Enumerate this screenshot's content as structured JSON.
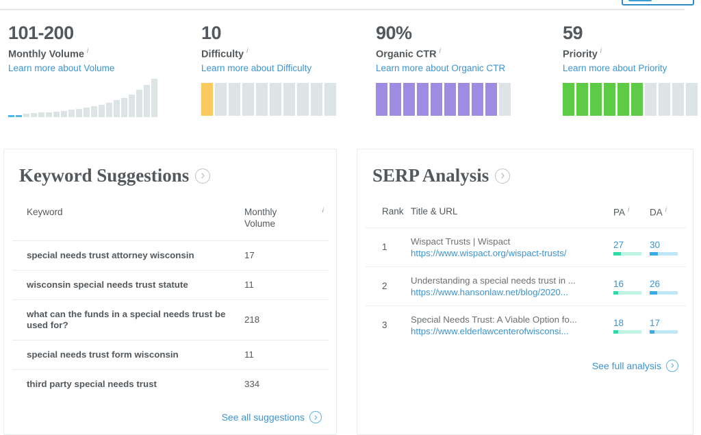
{
  "top_bar": {
    "button_name": "toolbar-button"
  },
  "metrics": [
    {
      "id": "monthly-volume",
      "value": "101-200",
      "label": "Monthly Volume",
      "info_icon": "info-icon",
      "link": "Learn more about Volume",
      "meter_type": "sparkline",
      "sparkline": {
        "bars": [
          3,
          3,
          5,
          6,
          7,
          7,
          8,
          9,
          11,
          12,
          14,
          16,
          18,
          21,
          25,
          29,
          34,
          41,
          48,
          57
        ],
        "highlight_count": 2,
        "highlight_color": "#4db8ec",
        "track_color": "#dde4e5"
      }
    },
    {
      "id": "difficulty",
      "value": "10",
      "label": "Difficulty",
      "info_icon": "info-icon",
      "link": "Learn more about Difficulty",
      "meter_type": "segments",
      "segments_total": 10,
      "segments_filled": 1,
      "fill_color": "#fbca5f",
      "track_color": "#dde4e5"
    },
    {
      "id": "organic-ctr",
      "value": "90%",
      "label": "Organic CTR",
      "info_icon": "info-icon",
      "link": "Learn more about Organic CTR",
      "meter_type": "segments",
      "segments_total": 10,
      "segments_filled": 9,
      "fill_color": "#9d8ce2",
      "track_color": "#dde4e5"
    },
    {
      "id": "priority",
      "value": "59",
      "label": "Priority",
      "info_icon": "info-icon",
      "link": "Learn more about Priority",
      "meter_type": "segments",
      "segments_total": 10,
      "segments_filled": 6,
      "fill_color": "#5ecb46",
      "track_color": "#dde4e5"
    }
  ],
  "keyword_suggestions": {
    "title": "Keyword Suggestions",
    "title_icon": "chevron-right-circle-icon",
    "columns": {
      "keyword": "Keyword",
      "monthly_volume": "Monthly Volume",
      "monthly_volume_info_icon": "info-icon"
    },
    "rows": [
      {
        "keyword": "special needs trust attorney wisconsin",
        "volume": "17"
      },
      {
        "keyword": "wisconsin special needs trust statute",
        "volume": "11"
      },
      {
        "keyword": "what can the funds in a special needs trust be used for?",
        "volume": "218"
      },
      {
        "keyword": "special needs trust form wisconsin",
        "volume": "11"
      },
      {
        "keyword": "third party special needs trust",
        "volume": "334"
      }
    ],
    "footer_link": "See all suggestions",
    "footer_icon": "chevron-right-circle-icon"
  },
  "serp_analysis": {
    "title": "SERP Analysis",
    "title_icon": "chevron-right-circle-icon",
    "columns": {
      "rank": "Rank",
      "title_url": "Title & URL",
      "pa": "PA",
      "pa_info_icon": "info-icon",
      "da": "DA",
      "da_info_icon": "info-icon"
    },
    "rows": [
      {
        "rank": "1",
        "title": "Wispact Trusts | Wispact",
        "url": "https://www.wispact.org/wispact-trusts/",
        "pa": "27",
        "da": "30"
      },
      {
        "rank": "2",
        "title": "Understanding a special needs trust in ...",
        "url": "https://www.hansonlaw.net/blog/2020...",
        "pa": "16",
        "da": "26"
      },
      {
        "rank": "3",
        "title": "Special Needs Trust: A Viable Option fo...",
        "url": "https://www.elderlawcenterofwisconsi...",
        "pa": "18",
        "da": "17"
      }
    ],
    "footer_link": "See full analysis",
    "footer_icon": "chevron-right-circle-icon"
  },
  "colors": {
    "link": "#3c93cf",
    "text": "#53585c",
    "border": "#e6ebec",
    "pa_fill": "#2fd9a8",
    "da_fill": "#36ace8"
  }
}
